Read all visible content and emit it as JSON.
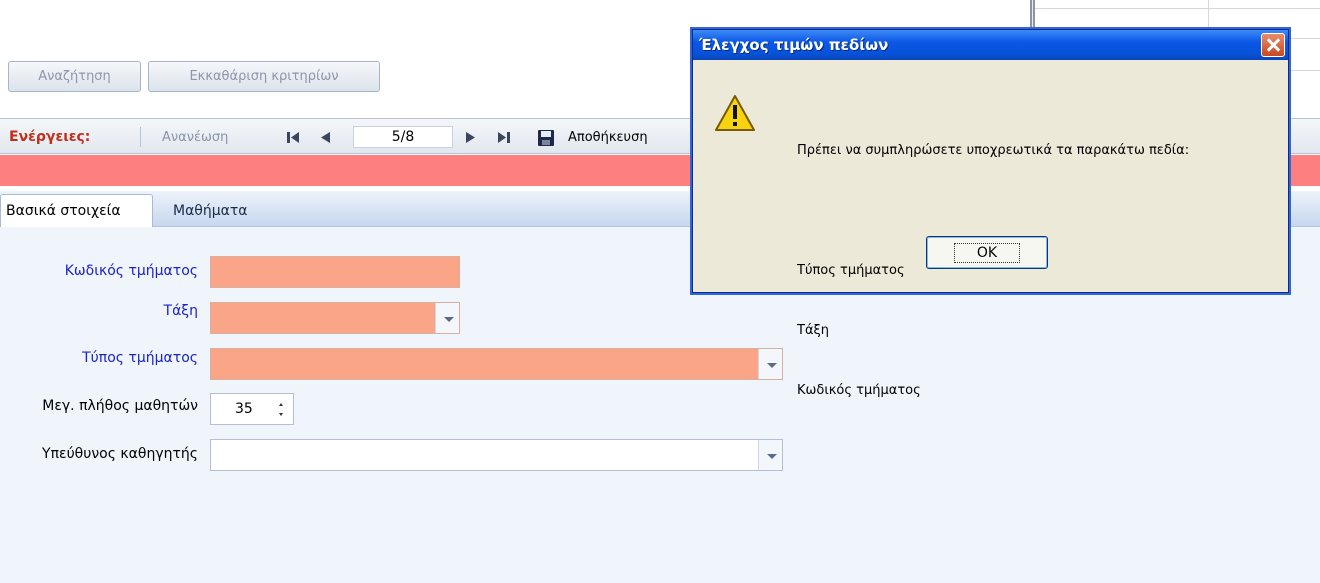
{
  "search": {
    "search_label": "Αναζήτηση",
    "clear_label": "Εκκαθάριση κριτηρίων"
  },
  "toolbar": {
    "actions_label": "Ενέργειες:",
    "refresh_label": "Ανανέωση",
    "record_position": "5/8",
    "save_label": "Αποθήκευση"
  },
  "tabs": [
    {
      "label": "Βασικά στοιχεία",
      "active": true
    },
    {
      "label": "Μαθήματα",
      "active": false
    }
  ],
  "form": {
    "code_label": "Κωδικός τμήματος",
    "class_label": "Τάξη",
    "type_label": "Τύπος τμήματος",
    "max_students_label": "Μεγ. πλήθος μαθητών",
    "max_students_value": "35",
    "teacher_label": "Υπεύθυνος καθηγητής"
  },
  "dialog": {
    "title": "Έλεγχος τιμών πεδίων",
    "message": "Πρέπει να συμπληρώσετε υποχρεωτικά τα παρακάτω πεδία:",
    "fields": [
      "Τύπος τμήματος",
      "Τάξη",
      "Κωδικός τμήματος"
    ],
    "ok_label": "OK",
    "icon": "warning-icon"
  },
  "colors": {
    "required_field": "#fba588",
    "error_strip": "#fd7f7f",
    "label_required": "#1a22c8",
    "dialog_title": "#0652d8"
  }
}
